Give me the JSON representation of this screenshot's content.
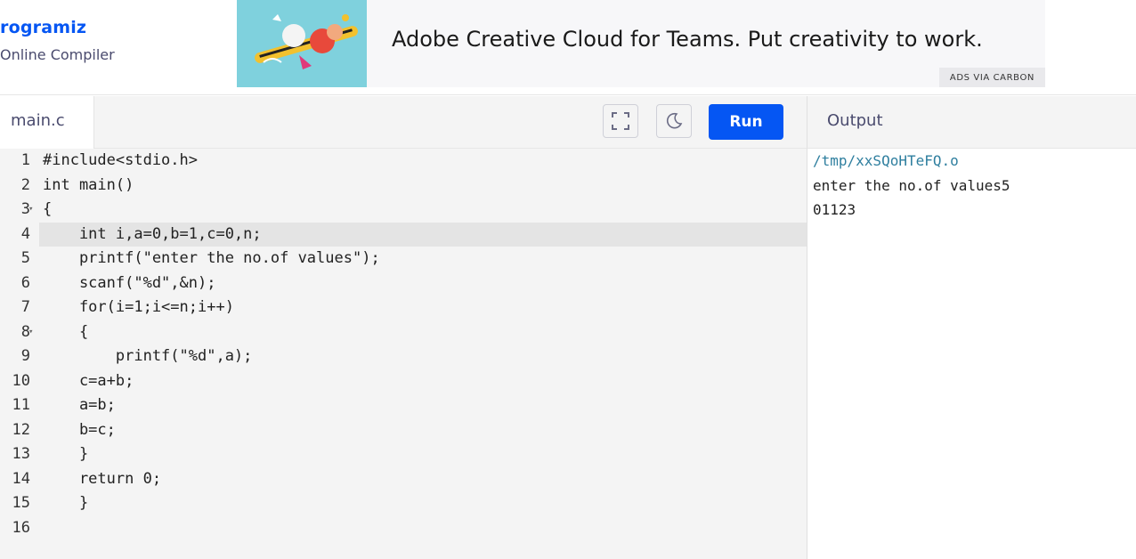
{
  "header": {
    "logo_text": "rogramiz",
    "subtitle": "Online Compiler"
  },
  "ad": {
    "text": "Adobe Creative Cloud for Teams. Put creativity to work.",
    "via": "ADS VIA CARBON"
  },
  "editor": {
    "tab_label": "main.c",
    "run_label": "Run",
    "lines": [
      "#include<stdio.h>",
      "int main()",
      "{",
      "    int i,a=0,b=1,c=0,n;",
      "    printf(\"enter the no.of values\");",
      "    scanf(\"%d\",&n);",
      "    for(i=1;i<=n;i++)",
      "    {",
      "        printf(\"%d\",a);",
      "    c=a+b;",
      "    a=b;",
      "    b=c;",
      "    }",
      "    return 0;",
      "    }",
      ""
    ],
    "line_numbers": [
      "1",
      "2",
      "3",
      "4",
      "5",
      "6",
      "7",
      "8",
      "9",
      "10",
      "11",
      "12",
      "13",
      "14",
      "15",
      "16"
    ],
    "active_line": 4
  },
  "output": {
    "title": "Output",
    "lines": [
      "/tmp/xxSQoHTeFQ.o",
      "enter the no.of values5",
      "01123"
    ]
  },
  "colors": {
    "brand": "#0556f3",
    "editor_bg": "#f4f4f4",
    "active_line_bg": "#e4e4e4"
  }
}
